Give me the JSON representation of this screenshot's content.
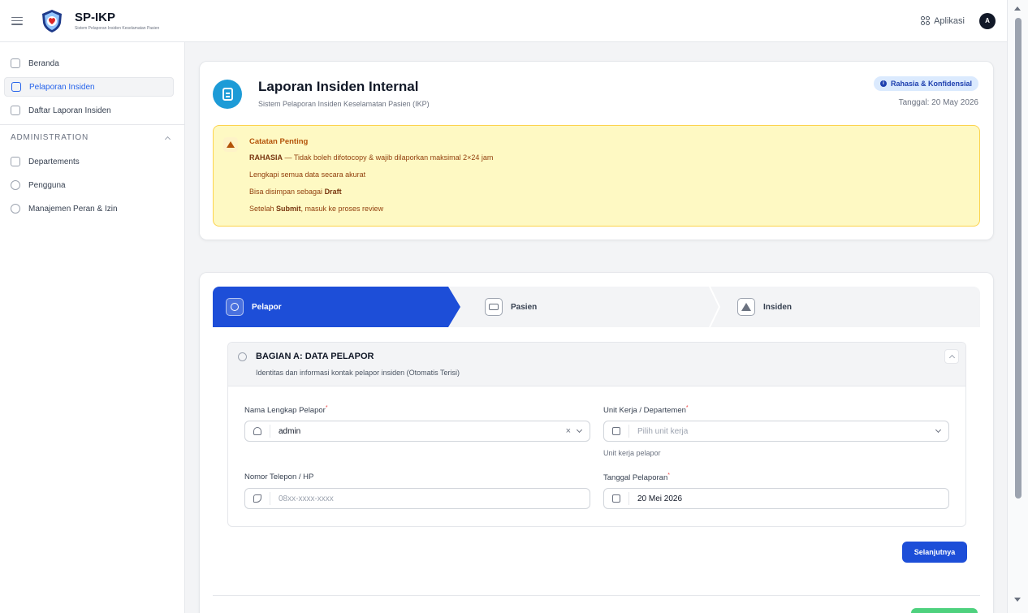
{
  "app": {
    "title": "SP-IKP",
    "subtitle": "Sistem Pelaporan Insiden Keselamatan Pasien",
    "apps_label": "Aplikasi",
    "avatar_initial": "A"
  },
  "sidebar": {
    "items": [
      {
        "label": "Beranda",
        "icon": "home-icon"
      },
      {
        "label": "Pelaporan Insiden",
        "icon": "file-icon",
        "active": true
      },
      {
        "label": "Daftar Laporan Insiden",
        "icon": "documents-icon"
      }
    ],
    "section_label": "ADMINISTRATION",
    "admin_items": [
      {
        "label": "Departements",
        "icon": "folder-icon"
      },
      {
        "label": "Pengguna",
        "icon": "users-icon"
      },
      {
        "label": "Manajemen Peran & Izin",
        "icon": "shield-check-icon"
      }
    ]
  },
  "header": {
    "title": "Laporan Insiden Internal",
    "subtitle": "Sistem Pelaporan Insiden Keselamatan Pasien (IKP)",
    "badge": "Rahasia & Konfidensial",
    "date": "Tanggal: 20 May 2026"
  },
  "notice": {
    "title": "Catatan Penting",
    "line1_bold": "RAHASIA",
    "line1_rest": " — Tidak boleh difotocopy & wajib dilaporkan maksimal 2×24 jam",
    "line2": "Lengkapi semua data secara akurat",
    "line3_pre": "Bisa disimpan sebagai ",
    "line3_bold": "Draft",
    "line4_pre": "Setelah ",
    "line4_bold": "Submit",
    "line4_post": ", masuk ke proses review"
  },
  "steps": [
    {
      "label": "Pelapor",
      "icon": "user-circle-icon",
      "active": true
    },
    {
      "label": "Pasien",
      "icon": "id-card-icon"
    },
    {
      "label": "Insiden",
      "icon": "warning-icon"
    }
  ],
  "section": {
    "title": "BAGIAN A: DATA PELAPOR",
    "description": "Identitas dan informasi kontak pelapor insiden (Otomatis Terisi)"
  },
  "fields": {
    "nama": {
      "label": "Nama Lengkap Pelapor",
      "required": "*",
      "value": "admin",
      "clear": "×"
    },
    "unit": {
      "label": "Unit Kerja / Departemen",
      "required": "*",
      "placeholder": "Pilih unit kerja",
      "helper": "Unit kerja pelapor"
    },
    "telepon": {
      "label": "Nomor Telepon / HP",
      "placeholder": "08xx-xxxx-xxxx"
    },
    "tanggal": {
      "label": "Tanggal Pelaporan",
      "required": "*",
      "value": "20 Mei 2026"
    }
  },
  "buttons": {
    "next": "Selanjutnya"
  },
  "colors": {
    "primary": "#1d4ed8",
    "accent": "#1d9bd7",
    "notice_bg": "#fef9c3",
    "badge_bg": "#dbeafe"
  }
}
